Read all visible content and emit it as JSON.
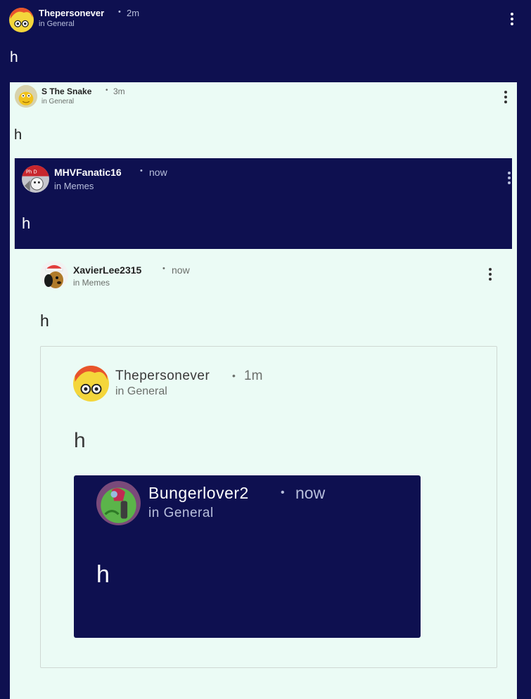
{
  "posts": [
    {
      "username": "Thepersonever",
      "separator": "•",
      "time": "2m",
      "community": "in General",
      "body": "h",
      "avatar_icon": "yellow-cartoon-avatar-icon"
    },
    {
      "username": "S The Snake",
      "separator": "•",
      "time": "3m",
      "community": "in General",
      "body": "h",
      "avatar_icon": "yellow-snake-avatar-icon"
    },
    {
      "username": "MHVFanatic16",
      "separator": "•",
      "time": "now",
      "community": "in Memes",
      "body": "h",
      "avatar_icon": "red-character-avatar-icon"
    },
    {
      "username": "XavierLee2315",
      "separator": "•",
      "time": "now",
      "community": "in Memes",
      "body": "h",
      "avatar_icon": "dog-with-cap-avatar-icon"
    },
    {
      "username": "Thepersonever",
      "separator": "•",
      "time": "1m",
      "community": "in General",
      "body": "h",
      "avatar_icon": "yellow-cartoon-avatar-icon"
    },
    {
      "username": "Bungerlover2",
      "separator": "•",
      "time": "now",
      "community": "in General",
      "body": "h",
      "avatar_icon": "green-plant-avatar-icon"
    }
  ],
  "colors": {
    "navy": "#0e1050",
    "mint": "#ebfbf5",
    "border": "#cfd8d3"
  }
}
